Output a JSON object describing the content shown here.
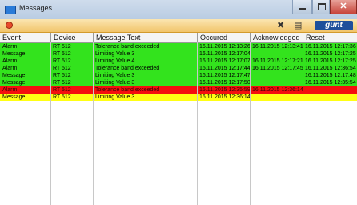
{
  "window": {
    "title": "Messages",
    "close_glyph": "✕",
    "logo_text": "gunt"
  },
  "icons": {
    "app": "window-app-icon",
    "status": "error-circle-icon",
    "tools": "tools-icon",
    "print": "printer-icon"
  },
  "colors": {
    "green": "#33e31d",
    "yellow": "#ffff14",
    "red": "#f40f0f",
    "toolbar": "#f5cf7a"
  },
  "columns": [
    "Event",
    "Device",
    "Message Text",
    "Occured",
    "Acknowledged",
    "Reset"
  ],
  "rows": [
    {
      "event": "Alarm",
      "device": "RT 512",
      "text": "Tolerance band exceeded",
      "occured": "16.11.2015 12:13:26",
      "ack": "16.11.2015 12:13:41",
      "reset": "16.11.2015 12:17:36",
      "status": "green"
    },
    {
      "event": "Message",
      "device": "RT 512",
      "text": "Limiting Value 3",
      "occured": "16.11.2015 12:17:04",
      "ack": "",
      "reset": "16.11.2015 12:17:25",
      "status": "green"
    },
    {
      "event": "Alarm",
      "device": "RT 512",
      "text": "Limiting Value 4",
      "occured": "16.11.2015 12:17:07",
      "ack": "16.11.2015 12:17:21",
      "reset": "16.11.2015 12:17:25",
      "status": "green"
    },
    {
      "event": "Alarm",
      "device": "RT 512",
      "text": "Tolerance band exceeded",
      "occured": "16.11.2015 12:17:44",
      "ack": "16.11.2015 12:17:45",
      "reset": "16.11.2015 12:36:54",
      "status": "green"
    },
    {
      "event": "Message",
      "device": "RT 512",
      "text": "Limiting Value 3",
      "occured": "16.11.2015 12:17:47",
      "ack": "",
      "reset": "16.11.2015 12:17:48",
      "status": "green"
    },
    {
      "event": "Message",
      "device": "RT 512",
      "text": "Limiting Value 3",
      "occured": "16.11.2015 12:17:50",
      "ack": "",
      "reset": "16.11.2015 12:35:54",
      "status": "green"
    },
    {
      "event": "Alarm",
      "device": "RT 512",
      "text": "Tolerance band exceeded",
      "occured": "16.11.2015 12:35:59",
      "ack": "16.11.2015 12:36:14",
      "reset": "",
      "status": "red"
    },
    {
      "event": "Message",
      "device": "RT 512",
      "text": "Limiting Value 3",
      "occured": "16.11.2015 12:36:14",
      "ack": "",
      "reset": "",
      "status": "yellow"
    }
  ]
}
